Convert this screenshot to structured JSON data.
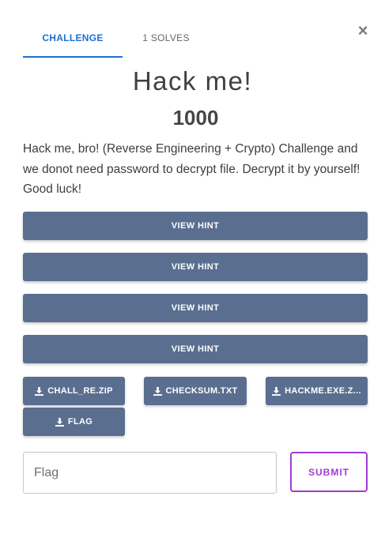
{
  "modal": {
    "close_symbol": "×"
  },
  "tabs": [
    {
      "label": "CHALLENGE",
      "active": true
    },
    {
      "label": "1 SOLVES",
      "active": false
    }
  ],
  "challenge": {
    "title": "Hack me!",
    "points": "1000",
    "description": "Hack me, bro! (Reverse Engineering + Crypto) Challenge and we donot need password to decrypt file. Decrypt it by yourself! Good luck!"
  },
  "hints": [
    {
      "label": "VIEW HINT"
    },
    {
      "label": "VIEW HINT"
    },
    {
      "label": "VIEW HINT"
    },
    {
      "label": "VIEW HINT"
    }
  ],
  "files": [
    {
      "label": "CHALL_RE.ZIP",
      "icon": "download-icon"
    },
    {
      "label": "CHECKSUM.TXT",
      "icon": "download-icon"
    },
    {
      "label": "HACKME.EXE.Z...",
      "icon": "download-icon"
    },
    {
      "label": "FLAG",
      "icon": "download-icon"
    }
  ],
  "submission": {
    "placeholder": "Flag",
    "value": "",
    "submit_label": "SUBMIT"
  },
  "colors": {
    "tab_active": "#1d6fd1",
    "button_bg": "#5a6e8f",
    "submit_accent": "#a239d6"
  }
}
